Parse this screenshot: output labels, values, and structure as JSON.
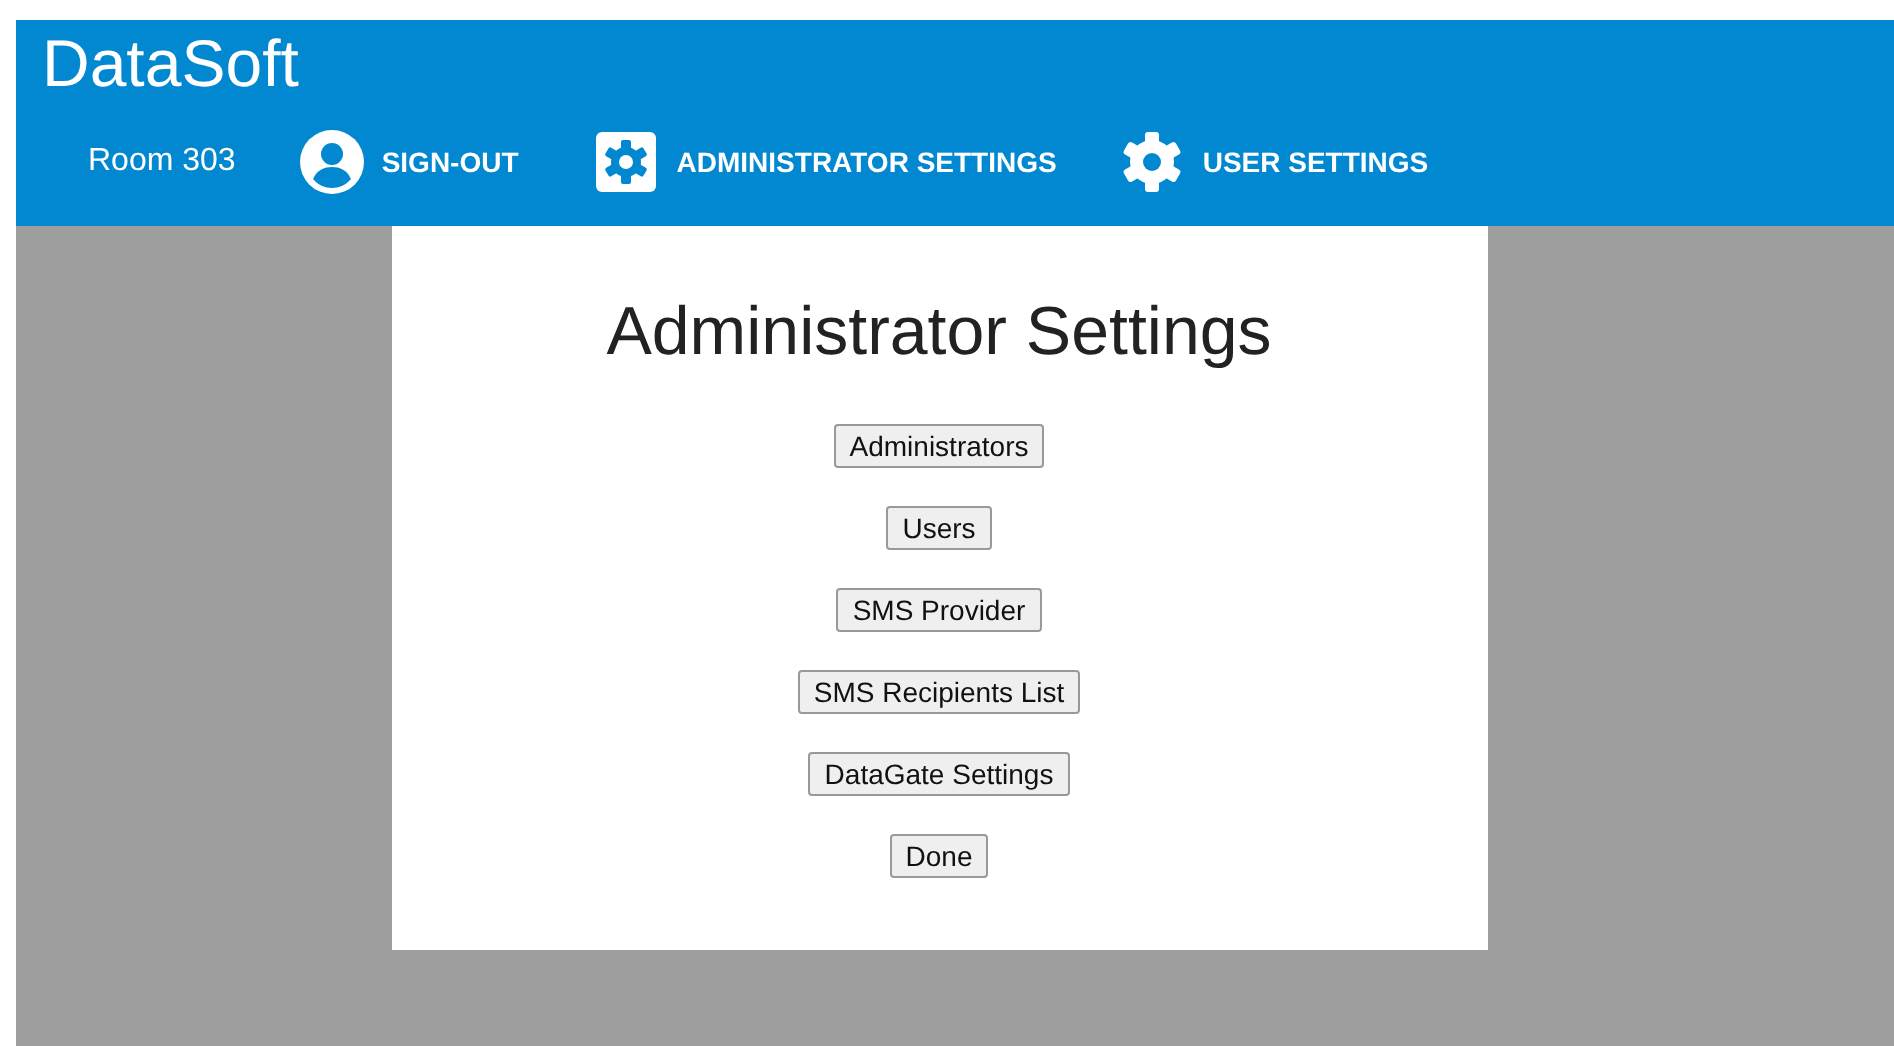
{
  "header": {
    "title": "DataSoft"
  },
  "nav": [
    {
      "kind": "text",
      "label": "Room 303"
    },
    {
      "kind": "person",
      "label": "SIGN-OUT"
    },
    {
      "kind": "gear-box",
      "label": "ADMINISTRATOR SETTINGS"
    },
    {
      "kind": "gear",
      "label": "USER SETTINGS"
    }
  ],
  "panel": {
    "title": "Administrator Settings",
    "buttons": [
      "Administrators",
      "Users",
      "SMS Provider",
      "SMS Recipients List",
      "DataGate Settings",
      "Done"
    ]
  }
}
